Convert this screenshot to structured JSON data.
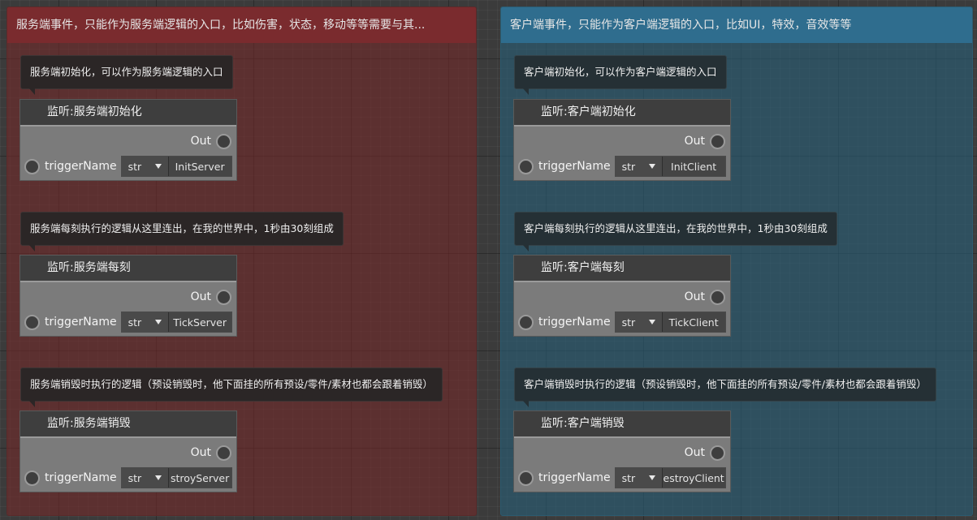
{
  "groups": [
    {
      "header": "服务端事件，只能作为服务端逻辑的入口，比如伤害，状态，移动等等需要与其...",
      "nodes": [
        {
          "comment": "服务端初始化，可以作为服务端逻辑的入口",
          "title": "监听:服务端初始化",
          "out_label": "Out",
          "input_label": "triggerName",
          "type": "str",
          "value": "InitServer"
        },
        {
          "comment": "服务端每刻执行的逻辑从这里连出，在我的世界中，1秒由30刻组成",
          "title": "监听:服务端每刻",
          "out_label": "Out",
          "input_label": "triggerName",
          "type": "str",
          "value": "TickServer"
        },
        {
          "comment": "服务端销毁时执行的逻辑（预设销毁时，他下面挂的所有预设/零件/素材也都会跟着销毁）",
          "title": "监听:服务端销毁",
          "out_label": "Out",
          "input_label": "triggerName",
          "type": "str",
          "value": "stroyServer"
        }
      ]
    },
    {
      "header": "客户端事件，只能作为客户端逻辑的入口，比如UI，特效，音效等等",
      "nodes": [
        {
          "comment": "客户端初始化，可以作为客户端逻辑的入口",
          "title": "监听:客户端初始化",
          "out_label": "Out",
          "input_label": "triggerName",
          "type": "str",
          "value": "InitClient"
        },
        {
          "comment": "客户端每刻执行的逻辑从这里连出，在我的世界中，1秒由30刻组成",
          "title": "监听:客户端每刻",
          "out_label": "Out",
          "input_label": "triggerName",
          "type": "str",
          "value": "TickClient"
        },
        {
          "comment": "客户端销毁时执行的逻辑（预设销毁时，他下面挂的所有预设/零件/素材也都会跟着销毁）",
          "title": "监听:客户端销毁",
          "out_label": "Out",
          "input_label": "triggerName",
          "type": "str",
          "value": "estroyClient"
        }
      ]
    }
  ]
}
